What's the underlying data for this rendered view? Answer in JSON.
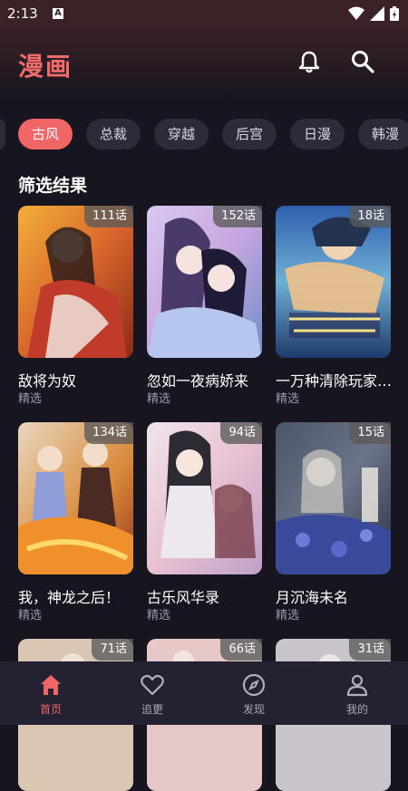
{
  "status": {
    "time": "2:13",
    "notif_glyph": "A"
  },
  "header": {
    "title": "漫画",
    "icons": [
      "bell-icon",
      "search-icon"
    ]
  },
  "tabs": [
    {
      "label": "古风",
      "active": true
    },
    {
      "label": "总裁",
      "active": false
    },
    {
      "label": "穿越",
      "active": false
    },
    {
      "label": "后宫",
      "active": false
    },
    {
      "label": "日漫",
      "active": false
    },
    {
      "label": "韩漫",
      "active": false
    }
  ],
  "section": {
    "title": "筛选结果"
  },
  "cards": [
    {
      "title": "敌将为奴",
      "subtitle": "精选",
      "badge": "111话"
    },
    {
      "title": "忽如一夜病娇来",
      "subtitle": "精选",
      "badge": "152话"
    },
    {
      "title": "一万种清除玩家的方法",
      "subtitle": "精选",
      "badge": "18话"
    },
    {
      "title": "我，神龙之后！",
      "subtitle": "精选",
      "badge": "134话"
    },
    {
      "title": "古乐风华录",
      "subtitle": "精选",
      "badge": "94话"
    },
    {
      "title": "月沉海未名",
      "subtitle": "精选",
      "badge": "15话"
    },
    {
      "title": "",
      "subtitle": "",
      "badge": "71话"
    },
    {
      "title": "",
      "subtitle": "",
      "badge": "66话"
    },
    {
      "title": "",
      "subtitle": "",
      "badge": "31话"
    }
  ],
  "nav": [
    {
      "label": "首页",
      "icon": "home-icon",
      "active": true
    },
    {
      "label": "追更",
      "icon": "heart-icon",
      "active": false
    },
    {
      "label": "发现",
      "icon": "compass-icon",
      "active": false
    },
    {
      "label": "我的",
      "icon": "profile-icon",
      "active": false
    }
  ],
  "colors": {
    "accent": "#f06666",
    "background": "#17151f",
    "nav_bg": "#242232",
    "chip_bg": "#2d2b3b"
  }
}
